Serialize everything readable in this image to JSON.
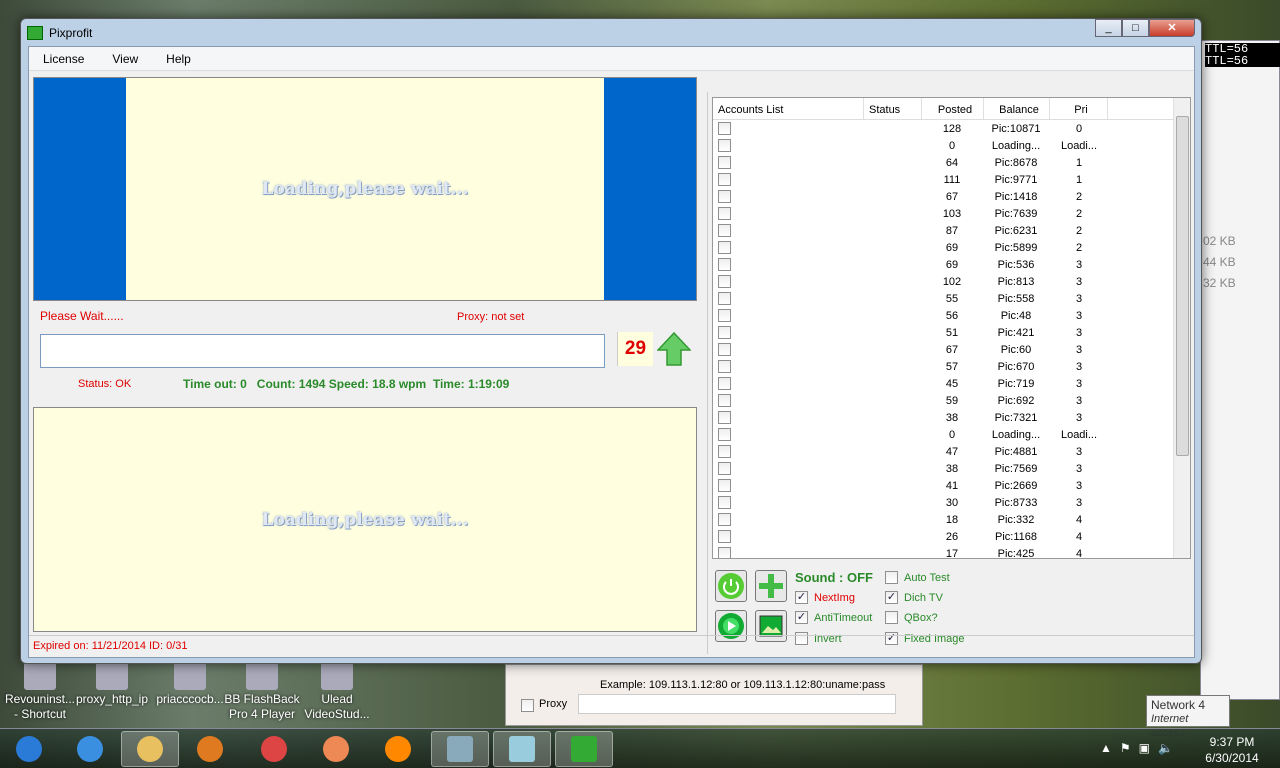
{
  "window": {
    "title": "Pixprofit"
  },
  "menu": [
    "License",
    "View",
    "Help"
  ],
  "main": {
    "loading_text": "Loading,please wait...",
    "please_wait": "Please Wait......",
    "proxy_status": "Proxy: not set",
    "captcha_input": "",
    "counter": "29",
    "status": "Status: OK",
    "stats": "Time out: 0   Count: 1494 Speed: 18.8 wpm  Time: 1:19:09"
  },
  "accounts": {
    "columns": [
      "Accounts List",
      "Status",
      "Posted",
      "Balance",
      "Pri"
    ],
    "rows": [
      [
        "128",
        "Pic:10871",
        "0"
      ],
      [
        "0",
        "Loading...",
        "Loadi..."
      ],
      [
        "64",
        "Pic:8678",
        "1"
      ],
      [
        "111",
        "Pic:9771",
        "1"
      ],
      [
        "67",
        "Pic:1418",
        "2"
      ],
      [
        "103",
        "Pic:7639",
        "2"
      ],
      [
        "87",
        "Pic:6231",
        "2"
      ],
      [
        "69",
        "Pic:5899",
        "2"
      ],
      [
        "69",
        "Pic:536",
        "3"
      ],
      [
        "102",
        "Pic:813",
        "3"
      ],
      [
        "55",
        "Pic:558",
        "3"
      ],
      [
        "56",
        "Pic:48",
        "3"
      ],
      [
        "51",
        "Pic:421",
        "3"
      ],
      [
        "67",
        "Pic:60",
        "3"
      ],
      [
        "57",
        "Pic:670",
        "3"
      ],
      [
        "45",
        "Pic:719",
        "3"
      ],
      [
        "59",
        "Pic:692",
        "3"
      ],
      [
        "38",
        "Pic:7321",
        "3"
      ],
      [
        "0",
        "Loading...",
        "Loadi..."
      ],
      [
        "47",
        "Pic:4881",
        "3"
      ],
      [
        "38",
        "Pic:7569",
        "3"
      ],
      [
        "41",
        "Pic:2669",
        "3"
      ],
      [
        "30",
        "Pic:8733",
        "3"
      ],
      [
        "18",
        "Pic:332",
        "4"
      ],
      [
        "26",
        "Pic:1168",
        "4"
      ],
      [
        "17",
        "Pic:425",
        "4"
      ]
    ]
  },
  "controls": {
    "sound": "Sound : OFF",
    "options": [
      {
        "label": "NextImg",
        "checked": true,
        "color": "#e00000"
      },
      {
        "label": "AntiTimeout",
        "checked": true,
        "color": "#2a8a2a"
      },
      {
        "label": "Invert",
        "checked": false,
        "color": "#2a8a2a"
      },
      {
        "label": "Auto Test",
        "checked": false,
        "color": "#2a8a2a"
      },
      {
        "label": "Dich TV",
        "checked": true,
        "color": "#2a8a2a"
      },
      {
        "label": "QBox?",
        "checked": false,
        "color": "#2a8a2a"
      },
      {
        "label": "Fixed Image",
        "checked": true,
        "color": "#2a8a2a"
      }
    ]
  },
  "statusbar": "Expired on: 11/21/2014  ID: 0/31",
  "background": {
    "proxy_example": "Example: 109.113.1.12:80 or 109.113.1.12:80:uname:pass",
    "proxy_label": "Proxy",
    "sizes": [
      "02 KB",
      "44 KB",
      "32 KB"
    ],
    "ttl": [
      "TTL=56",
      "TTL=56"
    ],
    "network": "Network 4",
    "network_sub": "Internet access"
  },
  "desktop": [
    {
      "l1": "Revouninst...",
      "l2": "- Shortcut"
    },
    {
      "l1": "proxy_http_ip",
      "l2": ""
    },
    {
      "l1": "priacccocb...",
      "l2": ""
    },
    {
      "l1": "BB FlashBack",
      "l2": "Pro 4 Player"
    },
    {
      "l1": "Ulead",
      "l2": "VideoStud..."
    }
  ],
  "taskbar": {
    "time": "9:37 PM",
    "date": "6/30/2014",
    "apps": [
      "start",
      "internet-explorer",
      "file-explorer",
      "media-player",
      "chrome",
      "firefox",
      "vlc",
      "app-window",
      "notepad",
      "code"
    ]
  }
}
